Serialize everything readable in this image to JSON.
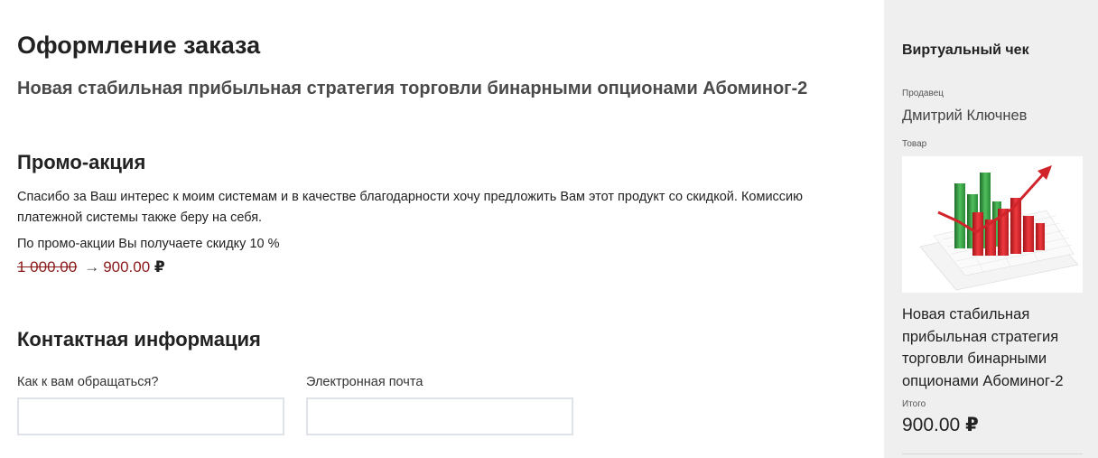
{
  "checkout": {
    "title": "Оформление заказа",
    "product_title": "Новая стабильная прибыльная стратегия торговли бинарными опционами Абоминог-2"
  },
  "promo": {
    "heading": "Промо-акция",
    "text": "Спасибо за Ваш интерес к моим системам и в качестве благодарности хочу предложить Вам этот продукт со скидкой. Комиссию платежной системы также беру на себя.",
    "discount_text": "По промо-акции Вы получаете скидку 10 %",
    "old_price": "1 000.00",
    "arrow": "→",
    "new_price": "900.00",
    "currency": "₽"
  },
  "contact": {
    "heading": "Контактная информация",
    "name_label": "Как к вам обращаться?",
    "name_value": "",
    "email_label": "Электронная почта",
    "email_value": ""
  },
  "receipt": {
    "title": "Виртуальный чек",
    "seller_label": "Продавец",
    "seller_name": "Дмитрий Ключнев",
    "product_label": "Товар",
    "product_name": "Новая стабильная прибыльная стратегия торговли бинарными опционами Абоминог-2",
    "total_label": "Итого",
    "total_amount": "900.00",
    "currency": "₽"
  },
  "colors": {
    "price_red": "#8b1a1a",
    "sidebar_bg": "#efefef",
    "chart_green": "#2e8b3a",
    "chart_red": "#d0242a"
  }
}
